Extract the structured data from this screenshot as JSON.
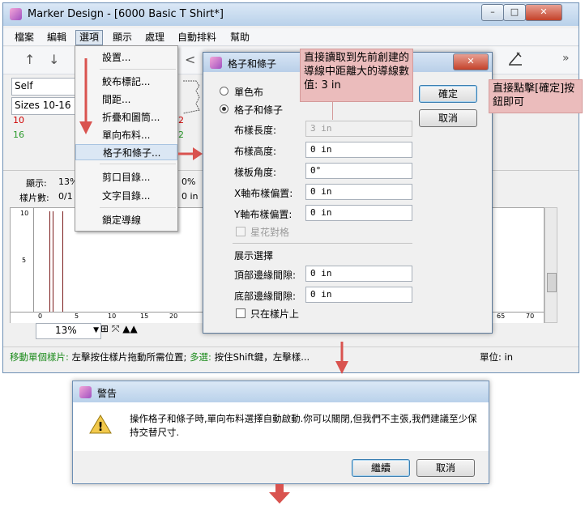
{
  "main_window": {
    "title": "Marker Design - [6000 Basic T Shirt*]",
    "caption_buttons": {
      "minimize": "–",
      "maximize": "□",
      "close": "✕"
    },
    "menus": [
      "檔案",
      "編輯",
      "選項",
      "顯示",
      "處理",
      "自動排料",
      "幫助"
    ],
    "toolbar": {
      "up_icon": "↑",
      "down_icon": "↓",
      "overflow_icon": "»",
      "bracket_icon": "<"
    },
    "combos": {
      "self": "Self",
      "sizes": "Sizes 10-16"
    },
    "grid_values": [
      {
        "text": "10",
        "color": "#d00000"
      },
      {
        "text": "16",
        "color": "#2a9a2a"
      },
      {
        "text": "2",
        "color": "#d00000"
      },
      {
        "text": "2",
        "color": "#2a9a2a"
      }
    ],
    "stats": {
      "display_label": "顯示:",
      "display_value": "13%",
      "pieces_label": "樣片數:",
      "pieces_value": "0/1",
      "percent_value": "0%",
      "in_value": "0 in"
    },
    "ruler_v_labels": [
      "10",
      "5"
    ],
    "ruler_h_labels": [
      "0",
      "5",
      "10",
      "15",
      "20",
      "65",
      "70"
    ],
    "zoom": {
      "value": "13%"
    },
    "status": {
      "hint_green": "移動單個樣片:",
      "hint_text": " 左擊按住樣片拖動所需位置; ",
      "hint_multi": "多選:",
      "hint_text2": " 按住Shift鍵，左擊樣...",
      "units": "單位: in"
    }
  },
  "dropdown_menu": {
    "items": [
      "設置...",
      "鮫布標記...",
      "間距...",
      "折疊和圖筒...",
      "單向布料...",
      "格子和條子...",
      "剪口目錄...",
      "文字目錄...",
      "鎖定導線"
    ],
    "highlighted": "格子和條子..."
  },
  "dialog": {
    "title": "格子和條子",
    "close": "✕",
    "radio_single": "單色布",
    "radio_plaid": "格子和條子",
    "fields": [
      {
        "label": "布樣長度:",
        "value": "3 in",
        "disabled": true
      },
      {
        "label": "布樣高度:",
        "value": "0 in",
        "disabled": false
      },
      {
        "label": "樣板角度:",
        "value": "0°",
        "disabled": false
      },
      {
        "label": "X軸布樣偏置:",
        "value": "0 in",
        "disabled": false
      },
      {
        "label": "Y軸布樣偏置:",
        "value": "0 in",
        "disabled": false
      }
    ],
    "star_align": "星花對格",
    "display_section": "展示選擇",
    "top_gap_label": "頂部邊緣間隙:",
    "top_gap_value": "0 in",
    "bottom_gap_label": "底部邊緣間隙:",
    "bottom_gap_value": "0 in",
    "only_on_piece": "只在樣片上",
    "ok": "確定",
    "cancel": "取消"
  },
  "callouts": {
    "left": "直接讀取到先前創建的導線中距離大的導線數值: 3 in",
    "right": "直接點擊[確定]按鈕即可"
  },
  "warning": {
    "title": "警告",
    "message": "操作格子和條子時,單向布料選擇自動啟動.你可以關閉,但我們不主張,我們建議至少保持交替尺寸.",
    "continue": "繼續",
    "cancel": "取消",
    "icon": "!"
  },
  "colors": {
    "arrow": "#d9534f",
    "callout": "#ebbcbc"
  }
}
